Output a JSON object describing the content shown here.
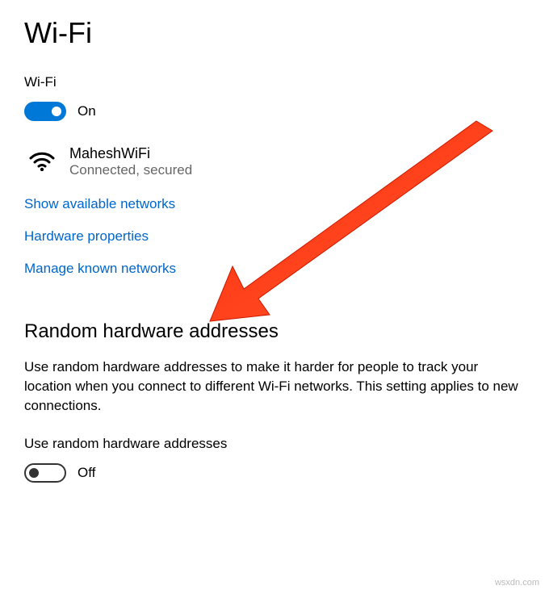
{
  "page": {
    "title": "Wi-Fi"
  },
  "wifi": {
    "section_label": "Wi-Fi",
    "toggle_state_label": "On",
    "toggle_on": true,
    "network": {
      "name": "MaheshWiFi",
      "status": "Connected, secured"
    },
    "links": {
      "show_available": "Show available networks",
      "hardware_properties": "Hardware properties",
      "manage_known": "Manage known networks"
    }
  },
  "random_hw": {
    "heading": "Random hardware addresses",
    "description": "Use random hardware addresses to make it harder for people to track your location when you connect to different Wi-Fi networks. This setting applies to new connections.",
    "toggle_label": "Use random hardware addresses",
    "toggle_state_label": "Off",
    "toggle_on": false
  },
  "colors": {
    "accent": "#0078d7",
    "link": "#0066cc",
    "arrow": "#ff3b1f"
  },
  "watermark": "wsxdn.com"
}
